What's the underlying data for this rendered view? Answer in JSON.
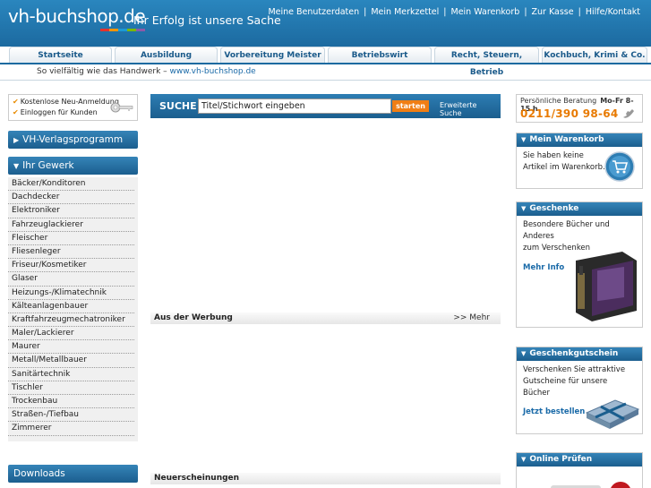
{
  "header": {
    "logo": "vh-buchshop.de",
    "slogan": "Ihr Erfolg ist unsere Sache",
    "topnav": [
      "Meine Benutzerdaten",
      "Mein Merkzettel",
      "Mein Warenkorb",
      "Zur Kasse",
      "Hilfe/Kontakt"
    ],
    "logo_bar_colors": [
      "#e5322d",
      "#f29400",
      "#1b9ad6",
      "#7ab800",
      "#8e5aa8"
    ]
  },
  "tabs": [
    "Startseite",
    "Ausbildung",
    "Vorbereitung Meister",
    "Betriebswirt",
    "Recht, Steuern, Betrieb",
    "Kochbuch, Krimi & Co."
  ],
  "subline": {
    "text": "So vielfältig wie das Handwerk – ",
    "link": "www.vh-buchshop.de"
  },
  "login": {
    "items": [
      "Kostenlose Neu-Anmeldung",
      "Einloggen für Kunden"
    ]
  },
  "nav": {
    "verlag": "VH-Verlagsprogramm",
    "gewerk": "Ihr Gewerk",
    "downloads": "Downloads",
    "gewerk_items": [
      "Bäcker/Konditoren",
      "Dachdecker",
      "Elektroniker",
      "Fahrzeuglackierer",
      "Fleischer",
      "Fliesenleger",
      "Friseur/Kosmetiker",
      "Glaser",
      "Heizungs-/Klimatechnik",
      "Kälteanlagenbauer",
      "Kraftfahrzeugmechatroniker",
      "Maler/Lackierer",
      "Maurer",
      "Metall/Metallbauer",
      "Sanitärtechnik",
      "Tischler",
      "Trockenbau",
      "Straßen-/Tiefbau",
      "Zimmerer"
    ]
  },
  "search": {
    "label": "SUCHE",
    "value": "Titel/Stichwort eingeben",
    "button": "starten",
    "advanced": "Erweiterte Suche"
  },
  "main": {
    "werbung": "Aus der Werbung",
    "more": ">> Mehr",
    "neu": "Neuerscheinungen"
  },
  "beratung": {
    "label": "Persönliche Beratung",
    "hours": "Mo-Fr 8-15 h",
    "phone": "0211/390 98-64"
  },
  "warenkorb": {
    "title": "Mein Warenkorb",
    "text1": "Sie haben keine",
    "text2": "Artikel im Warenkorb."
  },
  "geschenke": {
    "title": "Geschenke",
    "text1": "Besondere Bücher und Anderes",
    "text2": "zum Verschenken",
    "link": "Mehr Info"
  },
  "gutschein": {
    "title": "Geschenkgutschein",
    "text1": "Verschenken Sie attraktive",
    "text2": "Gutscheine für unsere Bücher",
    "link": "Jetzt bestellen"
  },
  "online": {
    "title": "Online Prüfen"
  }
}
